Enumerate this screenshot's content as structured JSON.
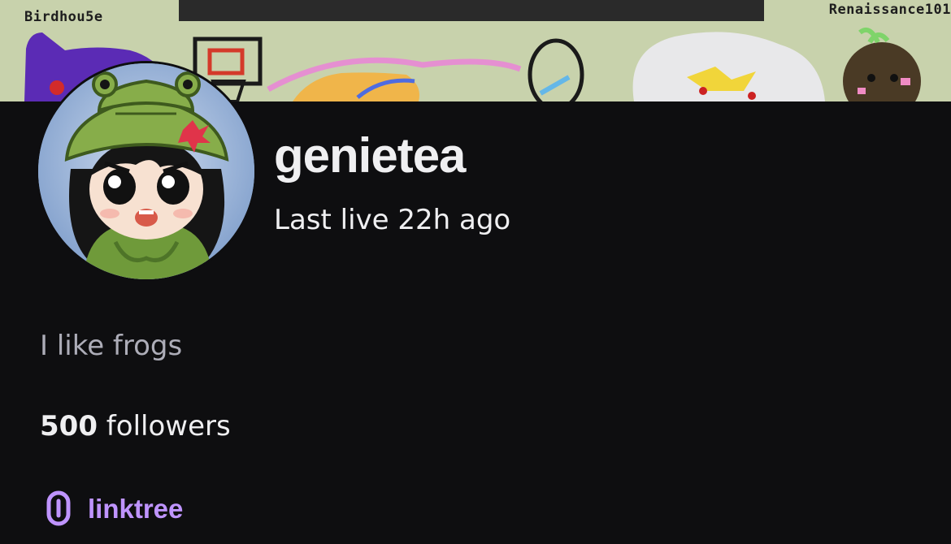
{
  "banner": {
    "credit_left": "Birdhou5e",
    "credit_right": "Renaissance101",
    "background_color": "#c8d2ac"
  },
  "profile": {
    "channel_name": "genietea",
    "last_live": "Last live 22h ago",
    "bio": "I like frogs",
    "followers_count": "500",
    "followers_label": "followers"
  },
  "social_link": {
    "icon": "link-icon",
    "label": "linktree",
    "color": "#bf94ff"
  },
  "colors": {
    "page_background": "#0e0e10",
    "text_primary": "#efeff1",
    "text_secondary": "#adadb8",
    "accent": "#bf94ff"
  }
}
